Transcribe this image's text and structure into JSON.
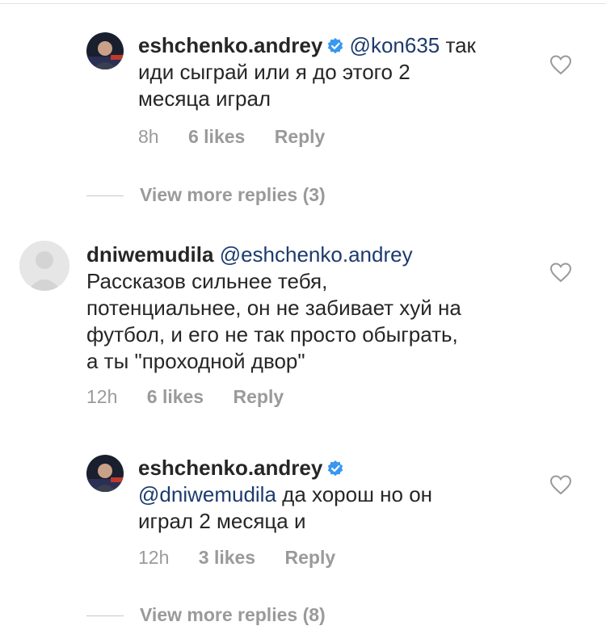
{
  "colors": {
    "text": "#262626",
    "meta": "#9a9a9a",
    "mention": "#1c3b6e",
    "verified": "#3897f0"
  },
  "comments": [
    {
      "username": "eshchenko.andrey",
      "verified": true,
      "lines": [
        "@kon635 так",
        "иди сыграй или я до этого 2",
        "месяца играл"
      ],
      "mention": "@kon635",
      "time": "8h",
      "likes": "6 likes",
      "reply": "Reply",
      "avatar_icon": "profile-photo"
    },
    {
      "username": "dniwemudila",
      "verified": false,
      "mention": "@eshchenko.andrey",
      "lines": [
        "Рассказов сильнее тебя,",
        "потенциальнее, он не забивает хуй на",
        "футбол, и его не так просто обыграть,",
        "а ты \"проходной двор\""
      ],
      "time": "12h",
      "likes": "6 likes",
      "reply": "Reply",
      "avatar_icon": "default-avatar"
    },
    {
      "username": "eshchenko.andrey",
      "verified": true,
      "mention": "@dniwemudila",
      "lines": [
        "да хорош но он",
        "играл 2 месяца и"
      ],
      "time": "12h",
      "likes": "3 likes",
      "reply": "Reply",
      "avatar_icon": "profile-photo"
    }
  ],
  "view_more": [
    "View more replies (3)",
    "View more replies (8)"
  ],
  "icons": {
    "like": "heart-outline-icon",
    "verified": "verified-badge-icon"
  }
}
